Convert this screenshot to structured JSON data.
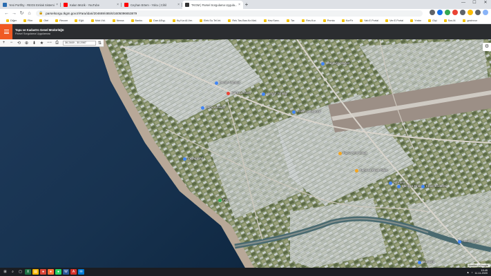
{
  "tabs": [
    {
      "title": "Yeni Portföy - REOS Emlak Sistemi",
      "favicon_color": "#2b6cb0",
      "active": false
    },
    {
      "title": "Kalan Müzik - YouTube",
      "favicon_color": "#ff0000",
      "active": false
    },
    {
      "title": "Ceyhan Ertem - Yolcu | Cihil",
      "favicon_color": "#ff0000",
      "active": false
    },
    {
      "title": "TKGM | Parsel Sorgulama Uygula...",
      "favicon_color": "#333333",
      "active": true
    }
  ],
  "new_tab_label": "+",
  "window_controls": {
    "minimize": "—",
    "maximize": "☐",
    "close": "✕"
  },
  "toolbar": {
    "back": "←",
    "forward": "→",
    "reload": "↻",
    "home": "⌂",
    "url": "parselsorgu.tkgm.gov.tr/#ara/idari/204669/465/6/1605096653879",
    "extension_colors": [
      "#5f6368",
      "#1a73e8",
      "#34a853",
      "#ea4335",
      "#5f6368",
      "#fbbc04",
      "#5f6368",
      "#8ab4f8"
    ]
  },
  "bookmarks": [
    {
      "label": "Diğer",
      "type": "folder"
    },
    {
      "label": "Film",
      "type": "folder"
    },
    {
      "label": "Otel",
      "type": "folder"
    },
    {
      "label": "Recom",
      "type": "folder"
    },
    {
      "label": "Eğit.",
      "type": "folder"
    },
    {
      "label": "Mob.Vid.",
      "type": "folder"
    },
    {
      "label": "Nexxa",
      "type": "folder"
    },
    {
      "label": "Banks",
      "type": "folder"
    },
    {
      "label": "Dan.&Eşy.",
      "type": "folder"
    },
    {
      "label": "Kş.Kur.Al.Ver.",
      "type": "folder"
    },
    {
      "label": "Elek.Su.Tel.İnt.",
      "type": "folder"
    },
    {
      "label": "Rek.Tas.Bas.Kır.Mat.",
      "type": "folder"
    },
    {
      "label": "Hav.Sanc.",
      "type": "folder"
    },
    {
      "label": "Tar.",
      "type": "folder"
    },
    {
      "label": "Res.Kur.",
      "type": "folder"
    },
    {
      "label": "Pnmta",
      "type": "folder"
    },
    {
      "label": "KurFir",
      "type": "folder"
    },
    {
      "label": "Yab.E.Portal",
      "type": "folder"
    },
    {
      "label": "Ver.E.Portal",
      "type": "folder"
    },
    {
      "label": "Ymbn",
      "type": "folder"
    },
    {
      "label": "Gişi",
      "type": "folder"
    },
    {
      "label": "Sos.M.",
      "type": "folder"
    },
    {
      "label": "gezinnor",
      "type": "folder"
    }
  ],
  "app": {
    "title": "Tapu ve Kadastro Genel Müdürlüğü",
    "subtitle": "Parsel Sorgulama Uygulaması",
    "accent": "#f05a23"
  },
  "map": {
    "tools": [
      "+",
      "−",
      "⟲",
      "⊕",
      "⬇",
      "★",
      "−−",
      "⎙"
    ],
    "coordinate": "36.2469 - 30.2987",
    "tool_extra": "⇅",
    "side_button": "⚙",
    "attribution": "Leaflet | Google",
    "labels": [
      {
        "text": "Gökçeoğlu Market",
        "kind": "place"
      },
      {
        "text": "Demre Nörobus",
        "kind": "place"
      },
      {
        "text": "Kumluca Tarım",
        "kind": "place"
      },
      {
        "text": "Hasyurt Yol Bilgi",
        "kind": "place"
      },
      {
        "text": "Serra Kumluca",
        "kind": "place"
      },
      {
        "text": "Finike Ali Fastfood",
        "kind": "place"
      },
      {
        "text": "Çayagzı Yol",
        "kind": "place"
      },
      {
        "text": "Pınar",
        "kind": "place"
      },
      {
        "text": "Kuzca Yerel Ziraat",
        "kind": "place"
      },
      {
        "text": "Kumluca Ziraat Odası",
        "kind": "place"
      },
      {
        "text": "Kumluca Dinlen",
        "kind": "place"
      },
      {
        "text": "Nil Parke",
        "kind": "place"
      },
      {
        "text": "Eksen Eczanesi",
        "kind": "place"
      },
      {
        "text": "Hoto Dergisi",
        "kind": "place"
      },
      {
        "text": "Mavikent",
        "kind": "place"
      }
    ]
  },
  "taskbar": {
    "apps": [
      {
        "icon": "windows-icon",
        "glyph": "⊞",
        "color": "#1b1d22"
      },
      {
        "icon": "search-icon",
        "glyph": "⌕",
        "color": "#1b1d22"
      },
      {
        "icon": "task-view-icon",
        "glyph": "▢",
        "color": "#1b1d22"
      },
      {
        "icon": "excel-icon",
        "glyph": "X",
        "color": "#1d6f42"
      },
      {
        "icon": "explorer-icon",
        "glyph": "▤",
        "color": "#f5b400"
      },
      {
        "icon": "chrome-icon",
        "glyph": "●",
        "color": "#db4437"
      },
      {
        "icon": "firefox-icon",
        "glyph": "●",
        "color": "#ff7139"
      },
      {
        "icon": "whatsapp-icon",
        "glyph": "●",
        "color": "#25d366"
      },
      {
        "icon": "word-icon",
        "glyph": "W",
        "color": "#2b579a"
      },
      {
        "icon": "acrobat-icon",
        "glyph": "A",
        "color": "#d4302b"
      },
      {
        "icon": "mail-icon",
        "glyph": "✉",
        "color": "#0078d4"
      }
    ],
    "time": "15:45",
    "date": "11.11.2020"
  }
}
